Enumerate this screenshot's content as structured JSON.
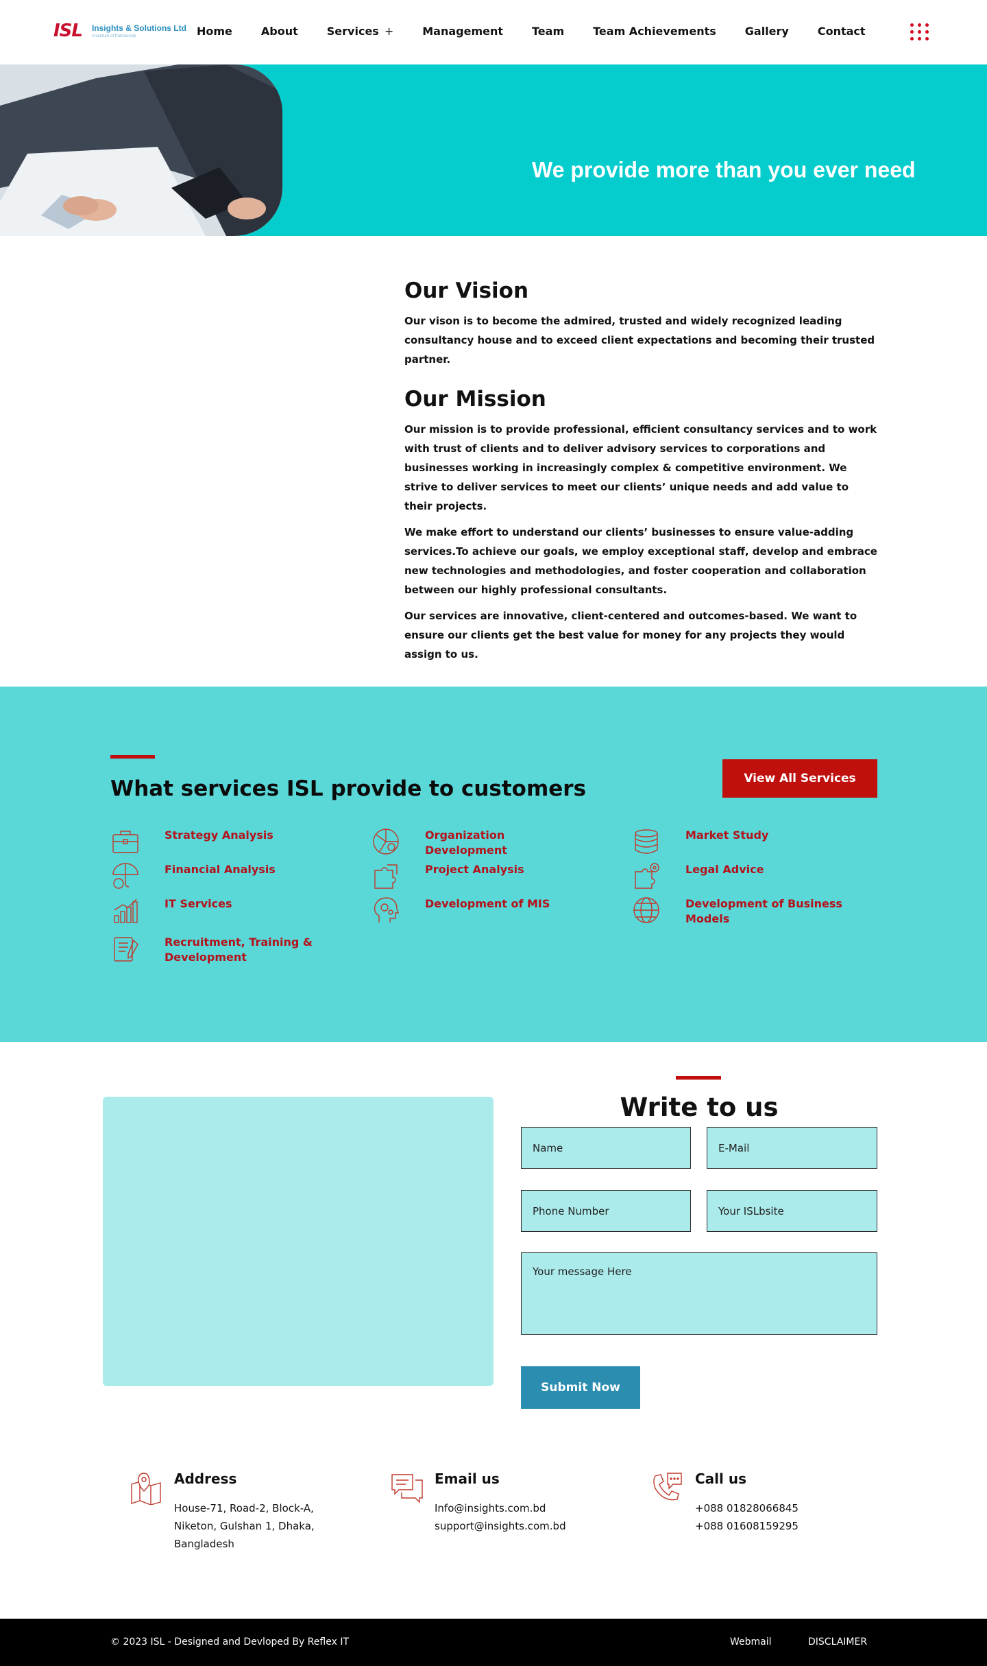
{
  "nav": {
    "logo_mark": "ISL",
    "logo_name": "Insights & Solutions Ltd",
    "logo_tag": "A venture of Partnership",
    "items": [
      {
        "label": "Home"
      },
      {
        "label": "About"
      },
      {
        "label": "Services",
        "suffix": "+"
      },
      {
        "label": "Management"
      },
      {
        "label": "Team"
      },
      {
        "label": "Team Achievements"
      },
      {
        "label": "Gallery"
      },
      {
        "label": "Contact"
      }
    ],
    "menu_icon": "grid-dots-icon"
  },
  "hero": {
    "headline": "We provide more than you ever need",
    "image": "handshake-business-photo"
  },
  "vision": {
    "vision_title": "Our Vision",
    "vision_text": "Our vison is to become the admired, trusted and widely recognized leading consultancy house and to exceed client expectations and becoming their trusted partner.",
    "mission_title": "Our Mission",
    "mission_paragraphs": [
      "Our mission is to provide professional, efficient consultancy services and to work with trust of clients and to deliver advisory services to corporations and businesses working in increasingly complex & competitive environment. We strive to deliver services to meet our clients’ unique needs and add value to their projects.",
      "We make effort to understand our clients’ businesses to ensure value-adding services.To achieve our goals, we employ exceptional staff, develop and embrace new technologies and methodologies, and foster cooperation and collaboration between our highly professional consultants.",
      "Our services are innovative, client-centered and outcomes-based. We want to ensure our clients get the best value for money for any projects they would assign to us."
    ]
  },
  "services": {
    "title": "What services ISL provide to customers",
    "view_all": "View All Services",
    "accent_color": "#c00d0d",
    "columns": [
      [
        {
          "label": "Strategy Analysis",
          "icon": "briefcase-icon"
        },
        {
          "label": "Financial Analysis",
          "icon": "umbrella-coin-icon"
        },
        {
          "label": "IT Services",
          "icon": "bar-chart-icon"
        },
        {
          "label": "Recruitment, Training & Development",
          "icon": "clipboard-pen-icon"
        }
      ],
      [
        {
          "label": "Organization Development",
          "icon": "pie-globe-icon"
        },
        {
          "label": "Project Analysis",
          "icon": "puzzle-icon"
        },
        {
          "label": "Development of MIS",
          "icon": "head-gears-icon"
        }
      ],
      [
        {
          "label": "Market Study",
          "icon": "coin-stack-icon"
        },
        {
          "label": "Legal Advice",
          "icon": "puzzle-gear-icon"
        },
        {
          "label": "Development of Business Models",
          "icon": "globe-icon"
        }
      ]
    ]
  },
  "contact": {
    "title": "Write to us",
    "name_placeholder": "Name",
    "email_placeholder": "E-Mail",
    "phone_placeholder": "Phone Number",
    "website_placeholder": "Your ISLbsite",
    "message_placeholder": "Your message Here",
    "submit": "Submit Now"
  },
  "info": {
    "address": {
      "title": "Address",
      "lines": [
        "House-71, Road-2, Block-A,",
        "Niketon, Gulshan 1, Dhaka,",
        "Bangladesh"
      ]
    },
    "email": {
      "title": "Email us",
      "lines": [
        "Info@insights.com.bd",
        "support@insights.com.bd"
      ]
    },
    "call": {
      "title": "Call us",
      "lines": [
        "+088 01828066845",
        "+088 01608159295"
      ]
    }
  },
  "footer": {
    "copyright": "© 2023 ISL - Designed and Devloped By Reflex IT",
    "webmail": "Webmail",
    "disclaimer": "DISCLAIMER"
  }
}
